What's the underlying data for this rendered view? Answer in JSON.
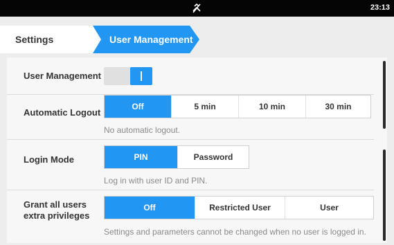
{
  "status_bar": {
    "time": "23:13",
    "center_icon": "no-signal-icon"
  },
  "breadcrumb": {
    "items": [
      {
        "label": "Settings"
      },
      {
        "label": "User Management"
      }
    ],
    "accent_color": "#2196f3"
  },
  "settings": {
    "user_management": {
      "label": "User Management",
      "enabled": true
    },
    "automatic_logout": {
      "label": "Automatic Logout",
      "options": [
        "Off",
        "5 min",
        "10 min",
        "30 min"
      ],
      "selected": "Off",
      "hint": "No automatic logout."
    },
    "login_mode": {
      "label": "Login Mode",
      "options": [
        "PIN",
        "Password"
      ],
      "selected": "PIN",
      "hint": "Log in with user ID and PIN."
    },
    "extra_privileges": {
      "label_line1": "Grant all users",
      "label_line2": "extra privileges",
      "options": [
        "Off",
        "Restricted User",
        "User"
      ],
      "selected": "Off",
      "hint": "Settings and parameters cannot be changed when no user is logged in."
    }
  }
}
